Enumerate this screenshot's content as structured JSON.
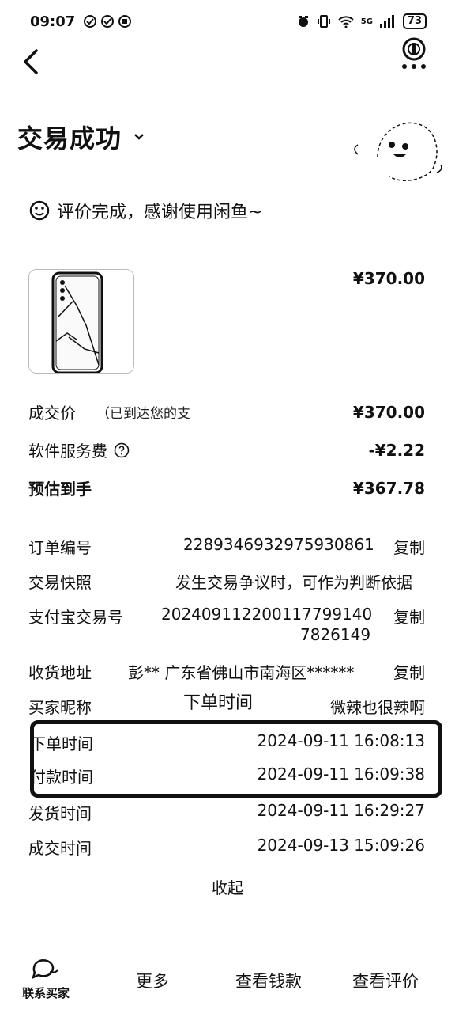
{
  "status_bar": {
    "time": "09:07",
    "battery": "73",
    "network": "5G"
  },
  "header": {
    "title": "交易成功"
  },
  "review": {
    "text": "评价完成，感谢使用闲鱼~"
  },
  "product": {
    "price": "¥370.00"
  },
  "price_rows": {
    "deal_price_label": "成交价",
    "deal_price_note": "（已到达您的支",
    "deal_price_value": "¥370.00",
    "service_fee_label": "软件服务费",
    "service_fee_value": "-¥2.22",
    "estimated_label": "预估到手",
    "estimated_value": "¥367.78"
  },
  "order_info": {
    "order_no_label": "订单编号",
    "order_no_value": "2289346932975930861",
    "copy_label": "复制",
    "snapshot_label": "交易快照",
    "snapshot_value": "发生交易争议时，可作为判断依据",
    "alipay_label": "支付宝交易号",
    "alipay_value_line1": "20240911220011779914​0",
    "alipay_value_line2": "7826149",
    "address_label": "收货地址",
    "address_value": "彭** 广东省佛山市南海区******",
    "buyer_label": "买家昵称",
    "buyer_value": "微辣也很辣啊",
    "order_time_label": "下单时间",
    "order_time_value": "2024-09-11 16:08:13",
    "pay_time_label": "付款时间",
    "pay_time_value": "2024-09-11 16:09:38",
    "ship_time_label": "发货时间",
    "ship_time_value": "2024-09-11 16:29:27",
    "deal_time_label": "成交时间",
    "deal_time_value": "2024-09-13 15:09:26",
    "overlay_label": "下单时间",
    "collapse_label": "收起"
  },
  "bottom_bar": {
    "contact_label": "联系买家",
    "more_label": "更多",
    "view_money_label": "查看钱款",
    "view_review_label": "查看评价"
  }
}
